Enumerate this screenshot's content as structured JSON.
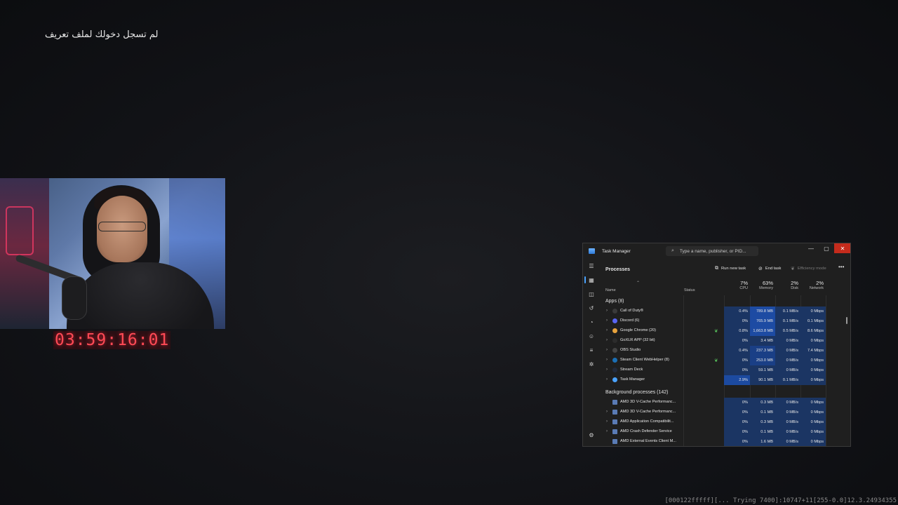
{
  "overlay": {
    "login_message": "لم تسجل دخولك لملف تعريف",
    "timer": "03:59:16:01",
    "debug_text": "[000122fffff][... Trying 7400]:10747+11[255-0.0]12.3.24934355"
  },
  "task_manager": {
    "title": "Task Manager",
    "search_placeholder": "Type a name, publisher, or PID...",
    "window_controls": {
      "minimize": "—",
      "maximize": "▢",
      "close": "✕"
    },
    "nav_icons": [
      "hamburger-icon",
      "processes-icon",
      "performance-icon",
      "app-history-icon",
      "startup-apps-icon",
      "users-icon",
      "details-icon",
      "services-icon",
      "settings-icon"
    ],
    "header": {
      "title": "Processes",
      "run_new_task": "Run new task",
      "end_task": "End task",
      "efficiency_mode": "Efficiency mode",
      "more": "•••"
    },
    "columns": {
      "name": "Name",
      "status": "Status",
      "cpu": {
        "pct": "7%",
        "label": "CPU"
      },
      "memory": {
        "pct": "63%",
        "label": "Memory"
      },
      "disk": {
        "pct": "2%",
        "label": "Disk"
      },
      "network": {
        "pct": "2%",
        "label": "Network"
      }
    },
    "apps_section": "Apps (8)",
    "apps": [
      {
        "name": "Call of Duty®",
        "cpu": "0.4%",
        "memory": "789.8 MB",
        "disk": "0.1 MB/s",
        "network": "0 Mbps",
        "icon_color": "#3a3a3a",
        "eco": false
      },
      {
        "name": "Discord (6)",
        "cpu": "0%",
        "memory": "765.9 MB",
        "disk": "0.1 MB/s",
        "network": "0.1 Mbps",
        "icon_color": "#5865f2",
        "eco": false
      },
      {
        "name": "Google Chrome (20)",
        "cpu": "0.8%",
        "memory": "1,663.8 MB",
        "disk": "0.5 MB/s",
        "network": "8.6 Mbps",
        "icon_color": "#e8a33d",
        "eco": true
      },
      {
        "name": "GoXLR APP (32 bit)",
        "cpu": "0%",
        "memory": "3.4 MB",
        "disk": "0 MB/s",
        "network": "0 Mbps",
        "icon_color": "#2c2c2c",
        "eco": false
      },
      {
        "name": "OBS Studio",
        "cpu": "0.4%",
        "memory": "237.3 MB",
        "disk": "0 MB/s",
        "network": "7.4 Mbps",
        "icon_color": "#444",
        "eco": false
      },
      {
        "name": "Steam Client WebHelper (8)",
        "cpu": "0%",
        "memory": "253.0 MB",
        "disk": "0 MB/s",
        "network": "0 Mbps",
        "icon_color": "#1b6fb5",
        "eco": true
      },
      {
        "name": "Stream Deck",
        "cpu": "0%",
        "memory": "59.1 MB",
        "disk": "0 MB/s",
        "network": "0 Mbps",
        "icon_color": "#222a3a",
        "eco": false
      },
      {
        "name": "Task Manager",
        "cpu": "2.9%",
        "memory": "90.1 MB",
        "disk": "0.1 MB/s",
        "network": "0 Mbps",
        "icon_color": "#4ba3ff",
        "eco": false
      }
    ],
    "bg_section": "Background processes (142)",
    "background": [
      {
        "name": "AMD 3D V-Cache Performanc...",
        "cpu": "0%",
        "memory": "0.3 MB",
        "disk": "0 MB/s",
        "network": "0 Mbps",
        "expand": false
      },
      {
        "name": "AMD 3D V-Cache Performanc...",
        "cpu": "0%",
        "memory": "0.1 MB",
        "disk": "0 MB/s",
        "network": "0 Mbps",
        "expand": true
      },
      {
        "name": "AMD Application Compatibilit...",
        "cpu": "0%",
        "memory": "0.3 MB",
        "disk": "0 MB/s",
        "network": "0 Mbps",
        "expand": true
      },
      {
        "name": "AMD Crash Defender Service",
        "cpu": "0%",
        "memory": "0.1 MB",
        "disk": "0 MB/s",
        "network": "0 Mbps",
        "expand": true
      },
      {
        "name": "AMD External Events Client M...",
        "cpu": "0%",
        "memory": "1.6 MB",
        "disk": "0 MB/s",
        "network": "0 Mbps",
        "expand": false
      }
    ]
  }
}
